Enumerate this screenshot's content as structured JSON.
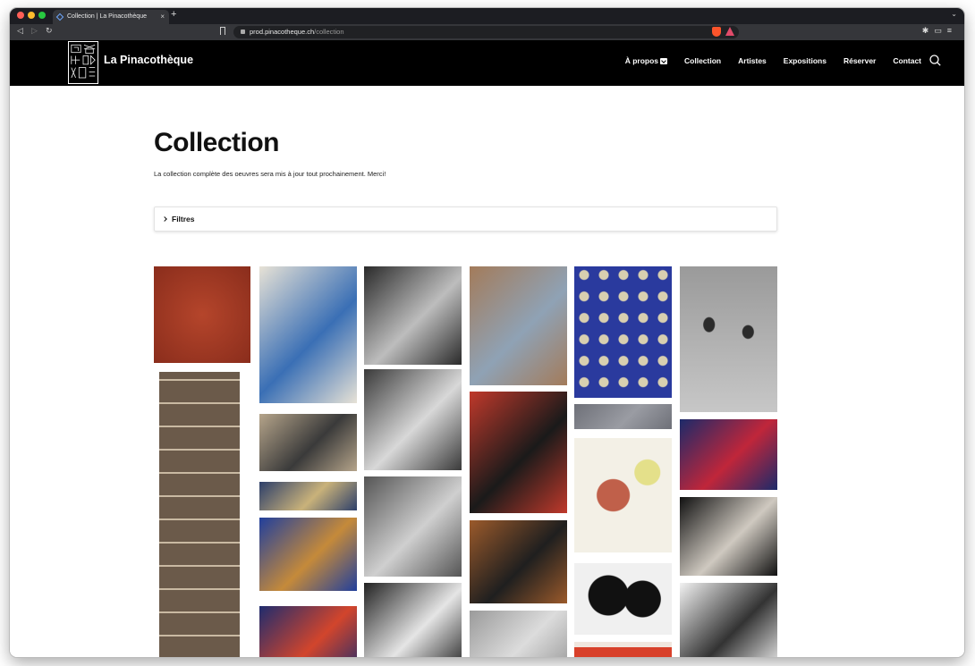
{
  "browser": {
    "tab_title": "Collection | La Pinacothèque",
    "tab_close": "×",
    "new_tab": "+",
    "url_host": "prod.pinacotheque.ch",
    "url_path": "/collection"
  },
  "site": {
    "brand": "La Pinacothèque",
    "nav": [
      {
        "label": "À propos",
        "has_dropdown": true
      },
      {
        "label": "Collection"
      },
      {
        "label": "Artistes"
      },
      {
        "label": "Expositions"
      },
      {
        "label": "Réserver"
      },
      {
        "label": "Contact"
      }
    ]
  },
  "page": {
    "title": "Collection",
    "intro": "La collection complète des oeuvres sera mis à jour tout prochainement. Merci!",
    "filters_label": "Filtres"
  },
  "gallery": {
    "columns": 6,
    "artworks": [
      {
        "name": "red-textile-artwork",
        "palette": [
          "#8a2d1c",
          "#b5452b"
        ]
      },
      {
        "name": "collage-column-artwork",
        "palette": [
          "#6b5a4a",
          "#c9b9a2"
        ]
      },
      {
        "name": "help-abstract-painting",
        "palette": [
          "#e7e2d6",
          "#3a6fb5"
        ]
      },
      {
        "name": "boxed-animal-assemblage",
        "palette": [
          "#b5a48a",
          "#3a3a3a"
        ]
      },
      {
        "name": "narrow-blue-panel",
        "palette": [
          "#2d3f6a",
          "#c9b27a"
        ]
      },
      {
        "name": "blue-figure-painting",
        "palette": [
          "#213f9c",
          "#c58a3a"
        ]
      },
      {
        "name": "colorful-block-painting",
        "palette": [
          "#1f2c6e",
          "#d2452c"
        ]
      },
      {
        "name": "bw-child-photo",
        "palette": [
          "#2a2a2a",
          "#bdbdbd"
        ]
      },
      {
        "name": "bw-flooded-forest-photo",
        "palette": [
          "#3a3a3a",
          "#d8d8d8"
        ]
      },
      {
        "name": "bw-relief-carving-photo",
        "palette": [
          "#555",
          "#cfcfcf"
        ]
      },
      {
        "name": "bw-waterfall-photo",
        "palette": [
          "#222",
          "#e5e5e5"
        ]
      },
      {
        "name": "street-scene-painting",
        "palette": [
          "#a37b5a",
          "#8fa2b5"
        ]
      },
      {
        "name": "cubist-city-painting",
        "palette": [
          "#c0392b",
          "#1a1a1a"
        ]
      },
      {
        "name": "abstract-brown-painting",
        "palette": [
          "#9b5a2b",
          "#1f1f1f"
        ]
      },
      {
        "name": "metal-sculpture-photo",
        "palette": [
          "#9a9a9a",
          "#dcdcdc"
        ]
      },
      {
        "name": "blue-skull-pattern",
        "palette": [
          "#2a3a9e",
          "#d8cfb0"
        ]
      },
      {
        "name": "grey-strip-artwork",
        "palette": [
          "#6e7078",
          "#9a9ca3"
        ]
      },
      {
        "name": "bird-drawing",
        "palette": [
          "#f3f0e6",
          "#c0604a"
        ]
      },
      {
        "name": "bw-figures-drawing",
        "palette": [
          "#111",
          "#f0f0f0"
        ]
      },
      {
        "name": "red-square-artwork",
        "palette": [
          "#d8402a",
          "#f0e6de"
        ]
      },
      {
        "name": "people-on-floor-photo",
        "palette": [
          "#9a9a9a",
          "#c7c7c7"
        ]
      },
      {
        "name": "blue-room-photo",
        "palette": [
          "#1c2a6a",
          "#c0263a"
        ]
      },
      {
        "name": "dark-landscape-photo",
        "palette": [
          "#111",
          "#cfc9c0"
        ]
      },
      {
        "name": "ink-wash-artwork",
        "palette": [
          "#f2f2f2",
          "#333"
        ]
      }
    ]
  }
}
